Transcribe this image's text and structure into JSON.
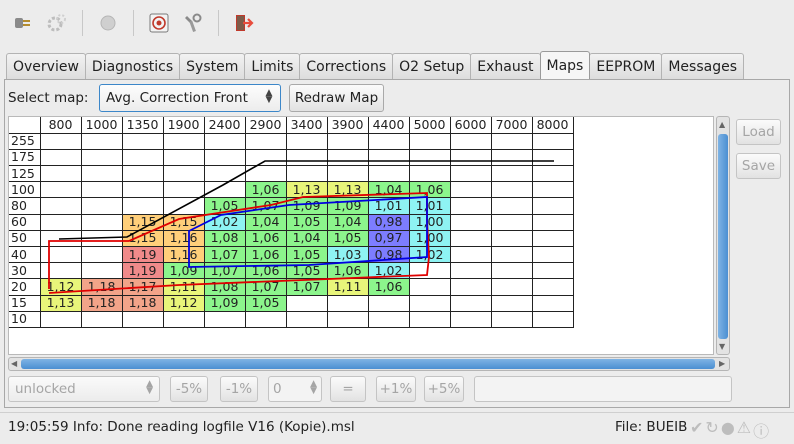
{
  "toolbar": {
    "icons": [
      "connect-icon",
      "settings-gear-icon",
      "record-icon",
      "target-icon",
      "tools-icon",
      "exit-icon"
    ]
  },
  "tabs": [
    {
      "label": "Overview"
    },
    {
      "label": "Diagnostics"
    },
    {
      "label": "System"
    },
    {
      "label": "Limits"
    },
    {
      "label": "Corrections"
    },
    {
      "label": "O2 Setup"
    },
    {
      "label": "Exhaust"
    },
    {
      "label": "Maps"
    },
    {
      "label": "EEPROM"
    },
    {
      "label": "Messages"
    }
  ],
  "active_tab": "Maps",
  "map_select": {
    "label": "Select map:",
    "value": "Avg. Correction Front",
    "redraw_label": "Redraw Map"
  },
  "side_buttons": {
    "load": "Load",
    "save": "Save"
  },
  "grid": {
    "col_headers": [
      "800",
      "1000",
      "1350",
      "1900",
      "2400",
      "2900",
      "3400",
      "3900",
      "4400",
      "5000",
      "6000",
      "7000",
      "8000"
    ],
    "rows": [
      {
        "label": "255",
        "cells": [
          "",
          "",
          "",
          "",
          "",
          "",
          "",
          "",
          "",
          "",
          "",
          "",
          ""
        ]
      },
      {
        "label": "175",
        "cells": [
          "",
          "",
          "",
          "",
          "",
          "",
          "",
          "",
          "",
          "",
          "",
          "",
          ""
        ]
      },
      {
        "label": "125",
        "cells": [
          "",
          "",
          "",
          "",
          "",
          "",
          "",
          "",
          "",
          "",
          "",
          "",
          ""
        ]
      },
      {
        "label": "100",
        "cells": [
          "",
          "",
          "",
          "",
          "",
          "1,06",
          "1,13",
          "1,13",
          "1,04",
          "1,06",
          "",
          "",
          ""
        ]
      },
      {
        "label": "80",
        "cells": [
          "",
          "",
          "",
          "",
          "1,05",
          "1,07",
          "1,09",
          "1,09",
          "1,01",
          "1,01",
          "",
          "",
          ""
        ]
      },
      {
        "label": "60",
        "cells": [
          "",
          "",
          "1,15",
          "1,15",
          "1,02",
          "1,04",
          "1,05",
          "1,04",
          "0,98",
          "1,00",
          "",
          "",
          ""
        ]
      },
      {
        "label": "50",
        "cells": [
          "",
          "",
          "1,15",
          "1,16",
          "1,08",
          "1,06",
          "1,04",
          "1,05",
          "0,97",
          "1,00",
          "",
          "",
          ""
        ]
      },
      {
        "label": "40",
        "cells": [
          "",
          "",
          "1,19",
          "1,16",
          "1,07",
          "1,06",
          "1,05",
          "1,03",
          "0,98",
          "1,02",
          "",
          "",
          ""
        ]
      },
      {
        "label": "30",
        "cells": [
          "",
          "",
          "1,19",
          "1,09",
          "1,07",
          "1,06",
          "1,05",
          "1,06",
          "1,02",
          "",
          "",
          "",
          ""
        ]
      },
      {
        "label": "20",
        "cells": [
          "1,12",
          "1,18",
          "1,17",
          "1,11",
          "1,08",
          "1,07",
          "1,07",
          "1,11",
          "1,06",
          "",
          "",
          "",
          ""
        ]
      },
      {
        "label": "15",
        "cells": [
          "1,13",
          "1,18",
          "1,18",
          "1,12",
          "1,09",
          "1,05",
          "",
          "",
          "",
          "",
          "",
          "",
          ""
        ]
      },
      {
        "label": "10",
        "cells": [
          "",
          "",
          "",
          "",
          "",
          "",
          "",
          "",
          "",
          "",
          "",
          "",
          ""
        ]
      }
    ],
    "colors": {
      "low": "#7d7dff",
      "mid_low": "#8ef3f3",
      "mid": "#8cf58c",
      "mid_high": "#e8f57a",
      "high_1": "#ffcf7a",
      "high_2": "#f2a489",
      "high_3": "#f08a8a"
    }
  },
  "controls": {
    "lock_state": "unlocked",
    "minus5": "-5%",
    "minus1": "-1%",
    "step_value": "0",
    "equals": "=",
    "plus1": "+1%",
    "plus5": "+5%"
  },
  "status": {
    "message": "19:05:59 Info: Done reading logfile V16 (Kopie).msl",
    "file": "File: BUEIB",
    "icons": [
      "check-icon",
      "refresh-icon",
      "circle-icon",
      "warning-icon",
      "info-icon"
    ]
  }
}
